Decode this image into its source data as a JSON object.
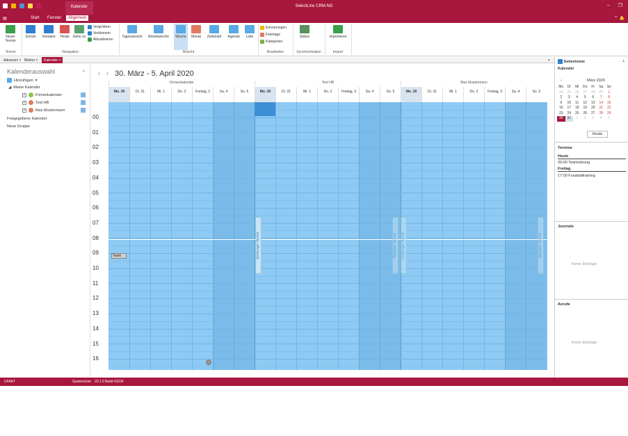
{
  "app": {
    "title": "SelectLine CRM.NG",
    "context_tab": "Kalender"
  },
  "menu": {
    "items": [
      "Start",
      "Fenster",
      "Allgemein"
    ]
  },
  "ribbon": {
    "termin": {
      "new": "Neuer Termin",
      "group": "Termin"
    },
    "navigation": {
      "back": "Zurück",
      "forward": "Vorwärts",
      "today": "Heute",
      "goto": "Gehe zu",
      "zoom_in": "Vergrößern",
      "zoom_out": "Verkleinern",
      "refresh": "Aktualisieren",
      "group": "Navigation"
    },
    "ansicht": {
      "items": [
        "Tagesansicht",
        "Arbeitswoche",
        "Woche",
        "Monat",
        "Zeitstrahl",
        "Agenda",
        "Liste"
      ],
      "group": "Ansicht"
    },
    "bearbeiten": {
      "items": [
        "Erinnerungen",
        "Feiertage",
        "Kategorien"
      ],
      "group": "Bearbeiten"
    },
    "sync": {
      "status": "Status",
      "group": "Synchronisation"
    },
    "import": {
      "btn": "Importieren",
      "group": "Import"
    }
  },
  "tabs": [
    "Adressen",
    "Bleiker",
    "Kalender"
  ],
  "left": {
    "title": "Kalenderauswahl",
    "add": "Hinzufügen",
    "my": "Meine Kalender",
    "cals": [
      {
        "name": "Firmenkalender",
        "color": "#7fb6e5",
        "checked": "✓"
      },
      {
        "name": "Test HB",
        "color": "#7fb6e5",
        "checked": "✓"
      },
      {
        "name": "Max Mustermann",
        "color": "#7fb6e5",
        "checked": "✓"
      }
    ],
    "shared": "Freigegebene Kalender",
    "newgroup": "Neue Gruppe"
  },
  "calendar": {
    "title": "30. März - 5. April 2020",
    "groups": [
      "Firmenkalender",
      "Test HB",
      "Max Mustermann"
    ],
    "days": [
      "Mo. 30",
      "Di. 31",
      "Mi. 1",
      "Do. 2",
      "Freitag, 3",
      "Sa. 4",
      "So. 5"
    ],
    "hours": [
      "00",
      "01",
      "02",
      "03",
      "04",
      "05",
      "06",
      "07",
      "08",
      "09",
      "10",
      "11",
      "12",
      "13",
      "14",
      "15",
      "16"
    ],
    "event": "Team",
    "prev": "Vorheriger Termin",
    "next": "Nächster Termin"
  },
  "sidebar": {
    "title": "Seitenleiste",
    "kalender": "Kalender",
    "month": "März 2020",
    "weekdays": [
      "Mo",
      "Di",
      "Mi",
      "Do",
      "Fr",
      "Sa",
      "So"
    ],
    "weeks": [
      [
        "24",
        "25",
        "26",
        "27",
        "28",
        "29",
        "1"
      ],
      [
        "2",
        "3",
        "4",
        "5",
        "6",
        "7",
        "8"
      ],
      [
        "9",
        "10",
        "11",
        "12",
        "13",
        "14",
        "15"
      ],
      [
        "16",
        "17",
        "18",
        "19",
        "20",
        "21",
        "22"
      ],
      [
        "23",
        "24",
        "25",
        "26",
        "27",
        "28",
        "29"
      ],
      [
        "30",
        "31",
        "1",
        "2",
        "3",
        "4",
        "5"
      ]
    ],
    "today_btn": "Heute",
    "termine": "Termine",
    "today_lbl": "Heute",
    "today_item": "09:00 Teamsitzung",
    "fri_lbl": "Freitag",
    "fri_item": "17:00 Fussballtraining",
    "journale": "Journale",
    "none": "Keine Einträge",
    "anrufe": "Anrufe",
    "none2": "Keine Einträge"
  },
  "status": {
    "left": "UFAKT",
    "user": "SystemUser",
    "version": "20.1.0 Build 43234"
  }
}
